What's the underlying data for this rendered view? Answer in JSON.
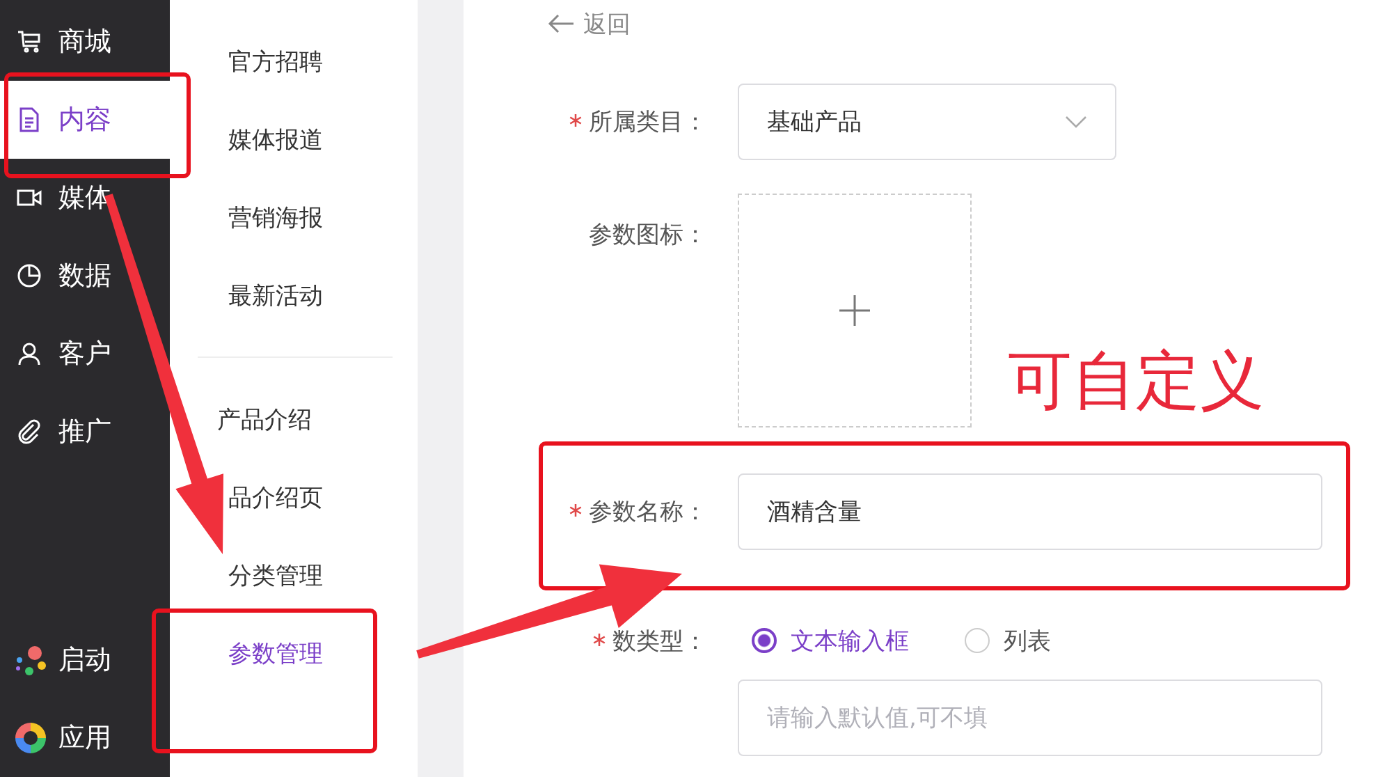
{
  "sidebar": {
    "items": [
      {
        "label": "商城",
        "selected": false
      },
      {
        "label": "内容",
        "selected": true
      },
      {
        "label": "媒体",
        "selected": false
      },
      {
        "label": "数据",
        "selected": false
      },
      {
        "label": "客户",
        "selected": false
      },
      {
        "label": "推广",
        "selected": false
      }
    ],
    "apps": [
      {
        "label": "启动"
      },
      {
        "label": "应用"
      }
    ]
  },
  "submenu": {
    "groups": [
      {
        "items": [
          {
            "label": "官方招聘",
            "selected": false
          },
          {
            "label": "媒体报道",
            "selected": false
          },
          {
            "label": "营销海报",
            "selected": false
          },
          {
            "label": "最新活动",
            "selected": false
          }
        ]
      },
      {
        "title": "产品介绍",
        "items": [
          {
            "label": "品介绍页",
            "selected": false
          },
          {
            "label": "分类管理",
            "selected": false
          },
          {
            "label": "参数管理",
            "selected": true
          }
        ]
      }
    ]
  },
  "back": {
    "label": "返回"
  },
  "form": {
    "fields": [
      {
        "kind": "select",
        "label": "所属类目：",
        "required": true,
        "value": "基础产品"
      },
      {
        "kind": "upload",
        "label": "参数图标：",
        "required": false
      },
      {
        "kind": "text",
        "label": "参数名称：",
        "required": true,
        "value": "酒精含量"
      },
      {
        "kind": "radio",
        "label": "数类型：",
        "required": true,
        "options": [
          {
            "label": "文本输入框",
            "selected": true
          },
          {
            "label": "列表",
            "selected": false
          }
        ],
        "placeholder": "请输入默认值,可不填"
      }
    ]
  },
  "annotation": {
    "note": "可自定义"
  }
}
